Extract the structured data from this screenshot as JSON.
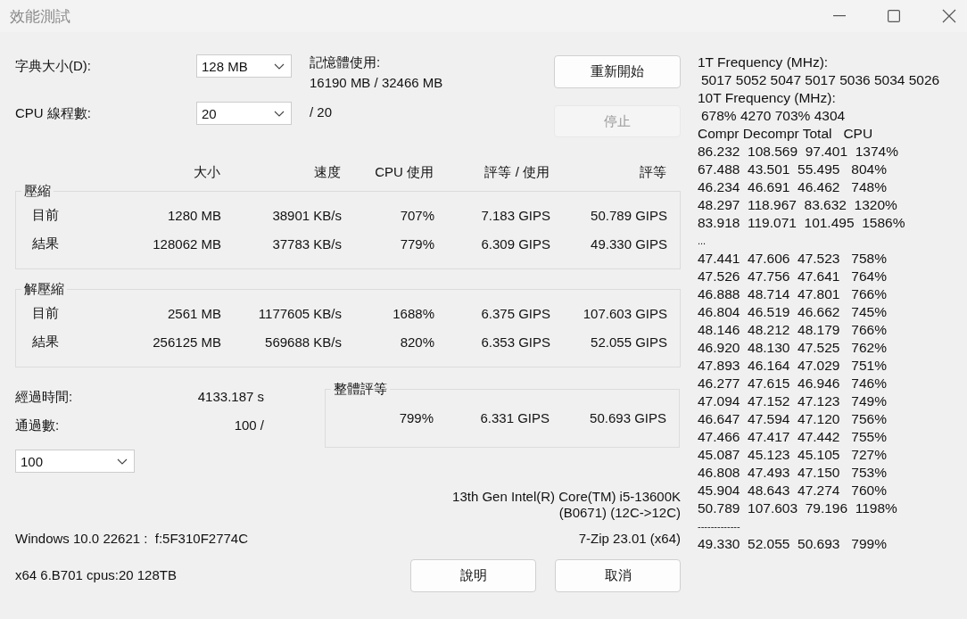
{
  "window": {
    "title": "效能測試"
  },
  "dictionary": {
    "label": "字典大小(D):",
    "value": "128 MB"
  },
  "memory": {
    "label": "記憶體使用:",
    "value": "16190 MB / 32466 MB"
  },
  "threads": {
    "label": "CPU 線程數:",
    "value": "20",
    "max": "/ 20"
  },
  "buttons_top": [
    {
      "label": "重新開始",
      "disabled": false
    },
    {
      "label": "停止",
      "disabled": true
    }
  ],
  "table": {
    "columns": [
      "大小",
      "速度",
      "CPU 使用",
      "評等 / 使用",
      "評等"
    ],
    "groups": [
      {
        "title": "壓縮",
        "rows": [
          {
            "label": "目前",
            "cells": [
              "1280 MB",
              "38901 KB/s",
              "707%",
              "7.183 GIPS",
              "50.789 GIPS"
            ]
          },
          {
            "label": "結果",
            "cells": [
              "128062 MB",
              "37783 KB/s",
              "779%",
              "6.309 GIPS",
              "49.330 GIPS"
            ]
          }
        ]
      },
      {
        "title": "解壓縮",
        "rows": [
          {
            "label": "目前",
            "cells": [
              "2561 MB",
              "1177605 KB/s",
              "1688%",
              "6.375 GIPS",
              "107.603 GIPS"
            ]
          },
          {
            "label": "結果",
            "cells": [
              "256125 MB",
              "569688 KB/s",
              "820%",
              "6.353 GIPS",
              "52.055 GIPS"
            ]
          }
        ]
      }
    ]
  },
  "elapsed": {
    "label": "經過時間:",
    "value": "4133.187 s"
  },
  "passes": {
    "label": "通過數:",
    "value": "100 /",
    "select": "100"
  },
  "overall": {
    "title": "整體評等",
    "cells": [
      "799%",
      "6.331 GIPS",
      "50.693 GIPS"
    ]
  },
  "cpu_info": [
    "13th Gen Intel(R) Core(TM) i5-13600K",
    "(B0671) (12C->12C)"
  ],
  "os_info": "Windows 10.0 22621 :  f:5F310F2774C",
  "version": "7-Zip 23.01 (x64)",
  "system_info": "x64 6.B701 cpus:20 128TB",
  "buttons_bottom": [
    {
      "label": "說明"
    },
    {
      "label": "取消"
    }
  ],
  "log": [
    {
      "kind": "plain",
      "text": "1T Frequency (MHz):"
    },
    {
      "kind": "indented",
      "text": "5017 5052 5047 5017 5036 5034 5026"
    },
    {
      "kind": "plain",
      "text": "10T Frequency (MHz):"
    },
    {
      "kind": "indented",
      "text": "678% 4270 703% 4304"
    },
    {
      "kind": "plain",
      "text": "Compr Decompr Total   CPU"
    },
    {
      "kind": "plain",
      "text": "86.232  108.569  97.401  1374%"
    },
    {
      "kind": "plain",
      "text": "67.488  43.501  55.495   804%"
    },
    {
      "kind": "plain",
      "text": "46.234  46.691  46.462   748%"
    },
    {
      "kind": "plain",
      "text": "48.297  118.967  83.632  1320%"
    },
    {
      "kind": "plain",
      "text": "83.918  119.071  101.495  1586%"
    },
    {
      "kind": "small",
      "text": "..."
    },
    {
      "kind": "plain",
      "text": "47.441  47.606  47.523   758%"
    },
    {
      "kind": "plain",
      "text": "47.526  47.756  47.641   764%"
    },
    {
      "kind": "plain",
      "text": "46.888  48.714  47.801   766%"
    },
    {
      "kind": "plain",
      "text": "46.804  46.519  46.662   745%"
    },
    {
      "kind": "plain",
      "text": "48.146  48.212  48.179   766%"
    },
    {
      "kind": "plain",
      "text": "46.920  48.130  47.525   762%"
    },
    {
      "kind": "plain",
      "text": "47.893  46.164  47.029   751%"
    },
    {
      "kind": "plain",
      "text": "46.277  47.615  46.946   746%"
    },
    {
      "kind": "plain",
      "text": "47.094  47.152  47.123   749%"
    },
    {
      "kind": "plain",
      "text": "46.647  47.594  47.120   756%"
    },
    {
      "kind": "plain",
      "text": "47.466  47.417  47.442   755%"
    },
    {
      "kind": "plain",
      "text": "45.087  45.123  45.105   727%"
    },
    {
      "kind": "plain",
      "text": "46.808  47.493  47.150   753%"
    },
    {
      "kind": "plain",
      "text": "45.904  48.643  47.274   760%"
    },
    {
      "kind": "plain",
      "text": "50.789  107.603  79.196  1198%"
    },
    {
      "kind": "small",
      "text": "-------------"
    },
    {
      "kind": "plain",
      "text": "49.330  52.055  50.693   799%"
    }
  ]
}
